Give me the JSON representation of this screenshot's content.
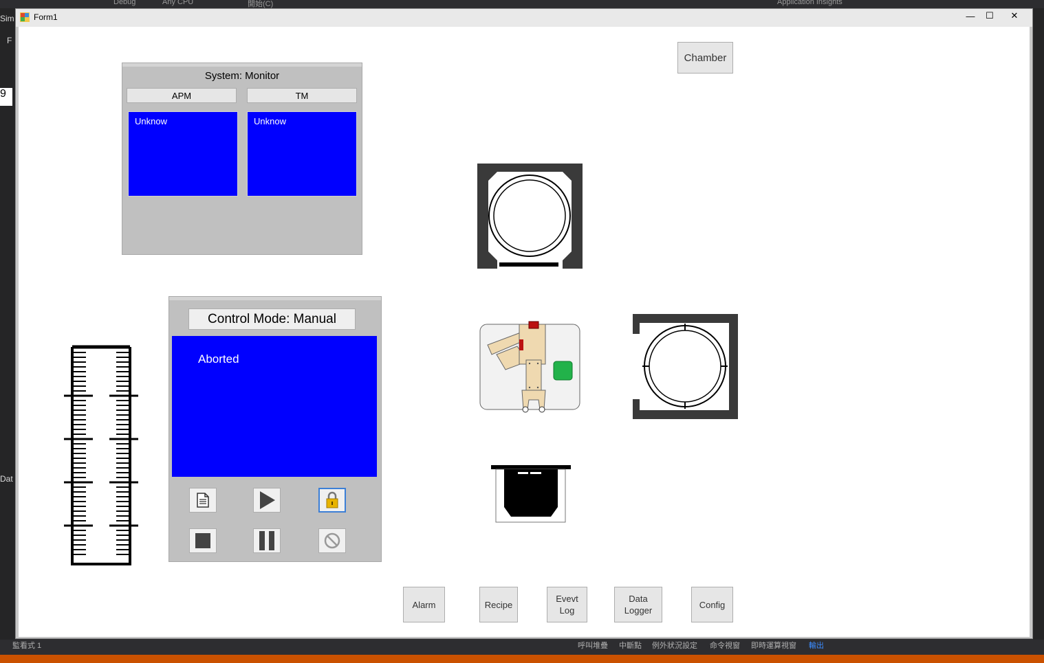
{
  "ide": {
    "toolbar": {
      "config": "Debug",
      "platform": "Any CPU",
      "start": "開始(C)",
      "insights": "Application Insights"
    },
    "left_fragments": [
      "Sim",
      "F",
      "9",
      "Dat"
    ],
    "status_items": [
      "監看式 1",
      "呼叫堆疊",
      "中斷點",
      "例外狀況設定",
      "命令視窗",
      "即時運算視窗",
      "輸出"
    ]
  },
  "window": {
    "title": "Form1",
    "controls": {
      "minimize": "—",
      "maximize": "☐",
      "close": "✕"
    }
  },
  "system_monitor": {
    "title": "System: Monitor",
    "buttons": [
      "APM",
      "TM"
    ],
    "boxes": [
      "Unknow",
      "Unknow"
    ],
    "box_color": "#0000ff"
  },
  "control_panel": {
    "mode_label": "Control Mode: Manual",
    "status_text": "Aborted",
    "status_color": "#0000ff",
    "buttons": [
      {
        "icon": "document-icon",
        "state": "normal"
      },
      {
        "icon": "play-icon",
        "state": "normal"
      },
      {
        "icon": "lock-icon",
        "state": "focused"
      },
      {
        "icon": "stop-icon",
        "state": "normal"
      },
      {
        "icon": "pause-icon",
        "state": "normal"
      },
      {
        "icon": "cancel-icon",
        "state": "normal"
      }
    ]
  },
  "chamber_button": "Chamber",
  "nav_buttons": [
    {
      "label": "Alarm"
    },
    {
      "label": "Recipe"
    },
    {
      "label": "Evevt\nLog"
    },
    {
      "label": "Data\nLogger"
    },
    {
      "label": "Config"
    }
  ],
  "equipment": {
    "process_chamber_1": "chamber-top-icon",
    "process_chamber_2": "chamber-right-icon",
    "robot": "robot-arm-icon",
    "load_port": "load-port-icon",
    "cassette": "cassette-icon"
  }
}
